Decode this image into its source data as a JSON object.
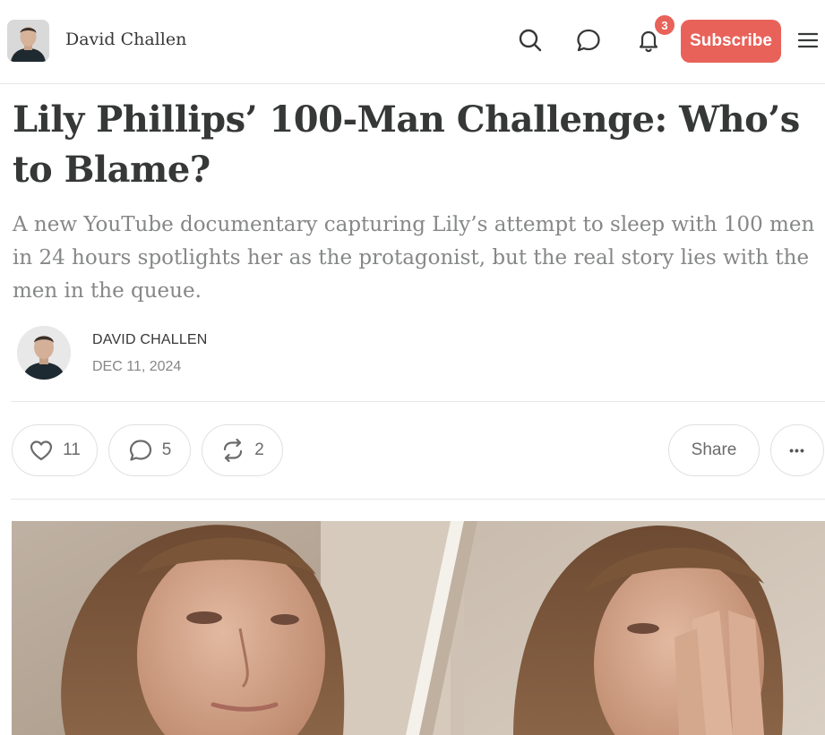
{
  "header": {
    "publication_name": "David Challen",
    "notification_count": "3",
    "subscribe_label": "Subscribe",
    "icons": [
      "search-icon",
      "chat-icon",
      "bell-icon",
      "menu-icon"
    ]
  },
  "article": {
    "title": "Lily Phillips’ 100-Man Challenge: Who’s to Blame?",
    "subtitle": "A new YouTube documentary capturing Lily’s attempt to sleep with 100 men in 24 hours spotlights her as the protagonist, but the real story lies with the men in the queue.",
    "author": "David Challen",
    "date": "Dec 11, 2024"
  },
  "actions": {
    "likes": "11",
    "comments": "5",
    "restacks": "2",
    "share_label": "Share",
    "more_label": "•••"
  },
  "colors": {
    "accent": "#e86259",
    "text": "#363737",
    "muted": "#868787",
    "border": "#e6e6e6"
  }
}
